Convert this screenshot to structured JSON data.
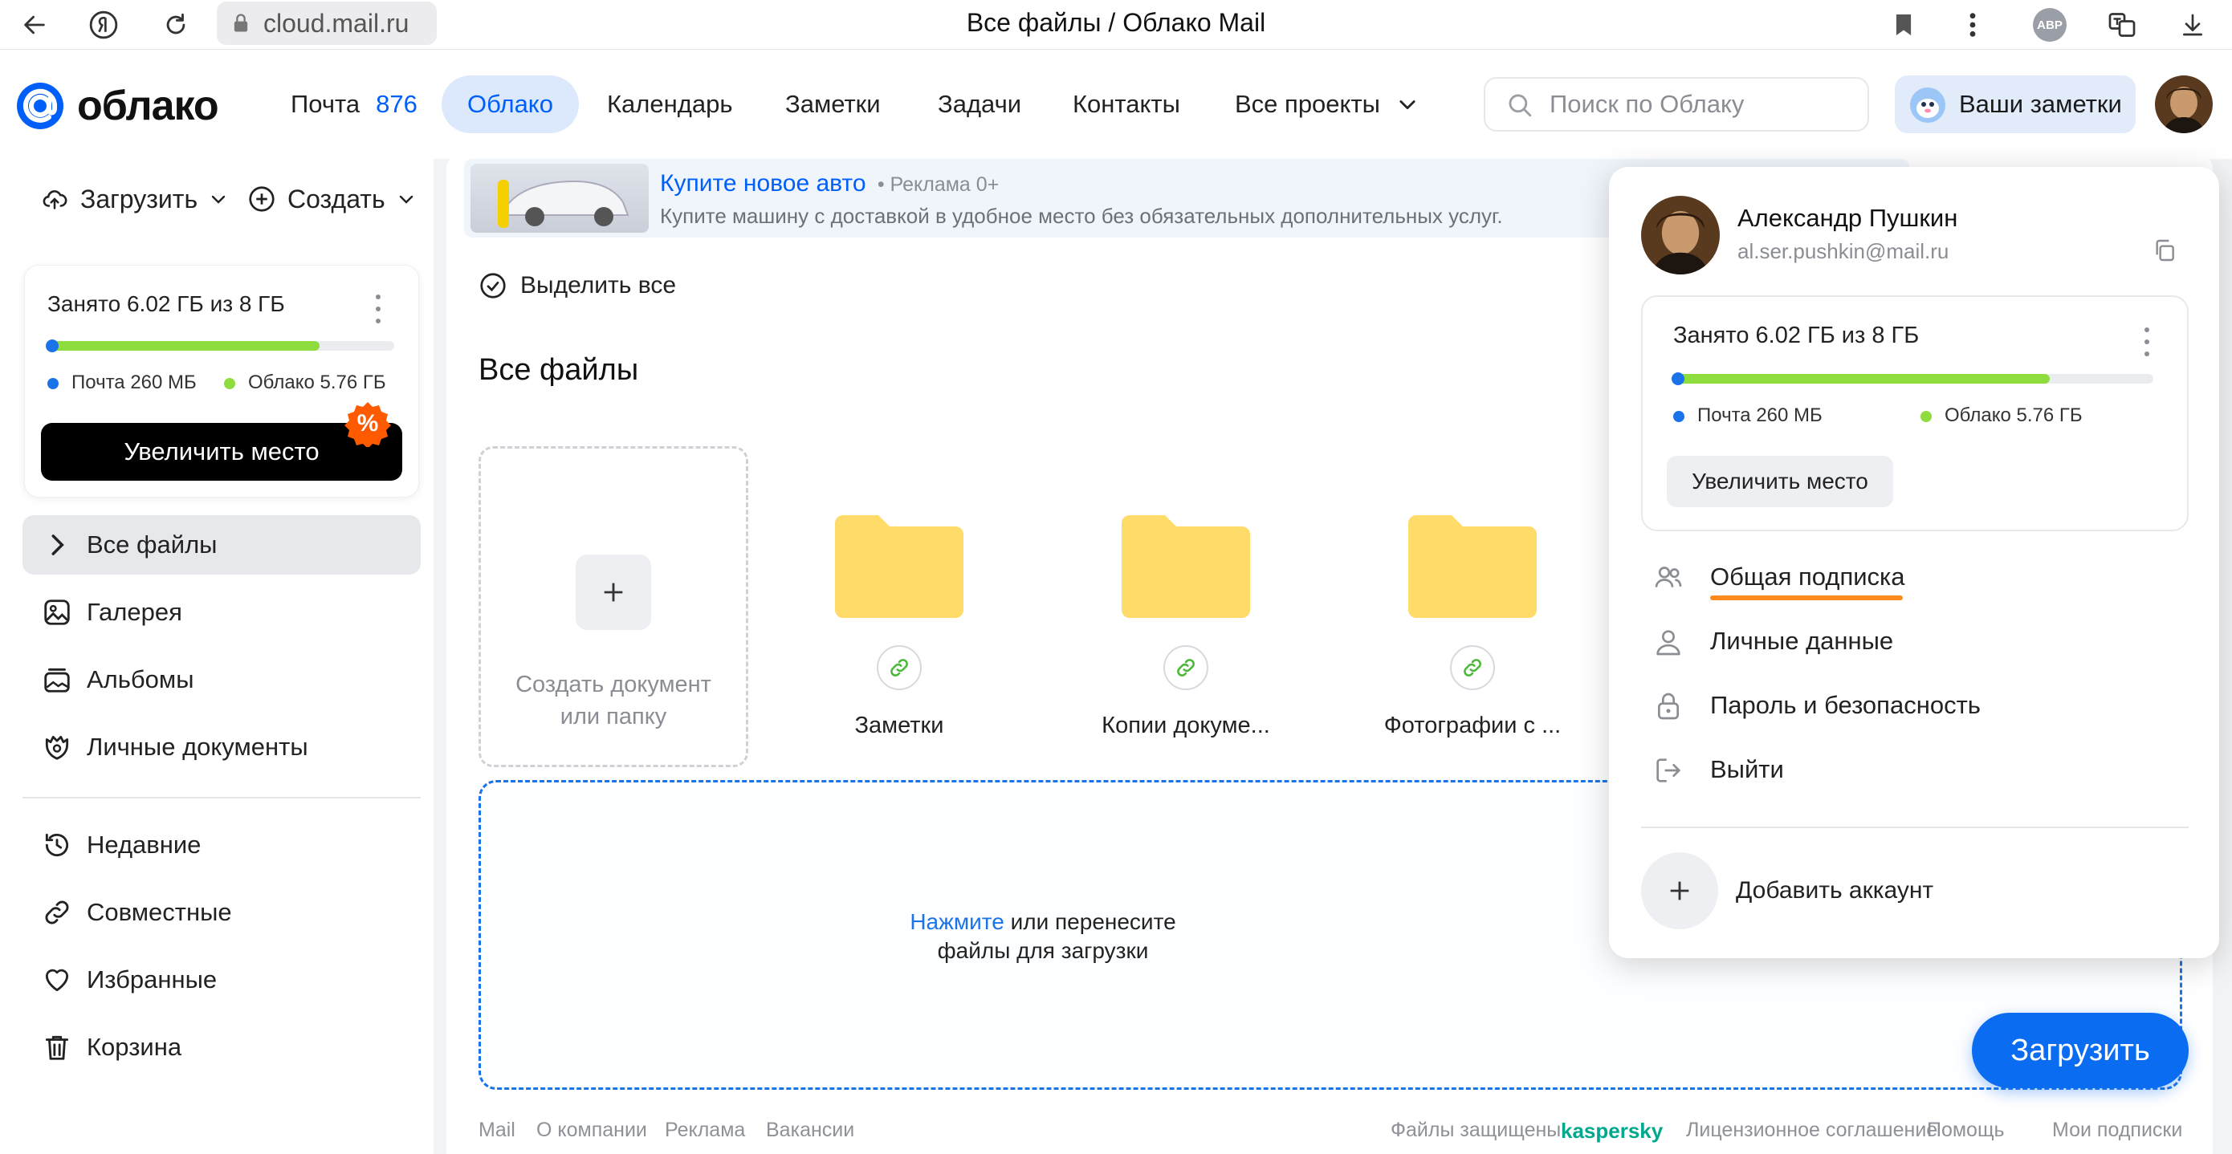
{
  "browser": {
    "url": "cloud.mail.ru",
    "tab_title": "Все файлы / Облако Mail",
    "abp_label": "ABP"
  },
  "header": {
    "logo_text": "облако",
    "nav": [
      {
        "label": "Почта",
        "count": "876"
      },
      {
        "label": "Облако"
      },
      {
        "label": "Календарь"
      },
      {
        "label": "Заметки"
      },
      {
        "label": "Задачи"
      },
      {
        "label": "Контакты"
      },
      {
        "label": "Все проекты"
      }
    ],
    "search_placeholder": "Поиск по Облаку",
    "notes_button": "Ваши заметки"
  },
  "sidebar": {
    "upload_label": "Загрузить",
    "create_label": "Создать",
    "storage": {
      "title": "Занято 6.02 ГБ из 8 ГБ",
      "used_fraction": 0.785,
      "mail_fraction": 0.032,
      "mail_legend": "Почта 260 МБ",
      "cloud_legend": "Облако 5.76 ГБ",
      "increase_button": "Увеличить место",
      "discount_badge": "%"
    },
    "items": [
      {
        "label": "Все файлы"
      },
      {
        "label": "Галерея"
      },
      {
        "label": "Альбомы"
      },
      {
        "label": "Личные документы"
      },
      {
        "label": "Недавние"
      },
      {
        "label": "Совместные"
      },
      {
        "label": "Избранные"
      },
      {
        "label": "Корзина"
      }
    ]
  },
  "ad": {
    "title": "Купите новое авто",
    "tag": "• Реклама 0+",
    "text": "Купите машину с доставкой в удобное место без обязательных дополнительных услуг."
  },
  "main": {
    "select_all": "Выделить все",
    "heading": "Все файлы",
    "create_tile_text": "Создать документ или папку",
    "folders": [
      {
        "name": "Заметки"
      },
      {
        "name": "Копии докуме..."
      },
      {
        "name": "Фотографии с ..."
      }
    ],
    "drop_link": "Нажмите",
    "drop_text_1": "или перенесите",
    "drop_text_2": "файлы для загрузки",
    "upload_button": "Загрузить"
  },
  "footer": {
    "left": [
      "Mail",
      "О компании",
      "Реклама",
      "Вакансии"
    ],
    "protected": "Файлы защищены",
    "kaspersky": "kaspersky",
    "right": [
      "Лицензионное соглашение",
      "Помощь",
      "Мои подписки"
    ]
  },
  "popup": {
    "name": "Александр Пушкин",
    "email": "al.ser.pushkin@mail.ru",
    "storage_title": "Занято 6.02 ГБ из 8 ГБ",
    "mail_legend": "Почта 260 МБ",
    "cloud_legend": "Облако 5.76 ГБ",
    "increase_button": "Увеличить место",
    "items": [
      {
        "label": "Общая подписка"
      },
      {
        "label": "Личные данные"
      },
      {
        "label": "Пароль и безопасность"
      },
      {
        "label": "Выйти"
      }
    ],
    "add_account": "Добавить аккаунт"
  },
  "colors": {
    "accent": "#005ff9",
    "cloud_bar": "#8fdc3f",
    "mail_dot": "#1a73e8",
    "folder": "#ffdb6a",
    "underline": "#ff8a1e",
    "kaspersky": "#00a88e"
  }
}
